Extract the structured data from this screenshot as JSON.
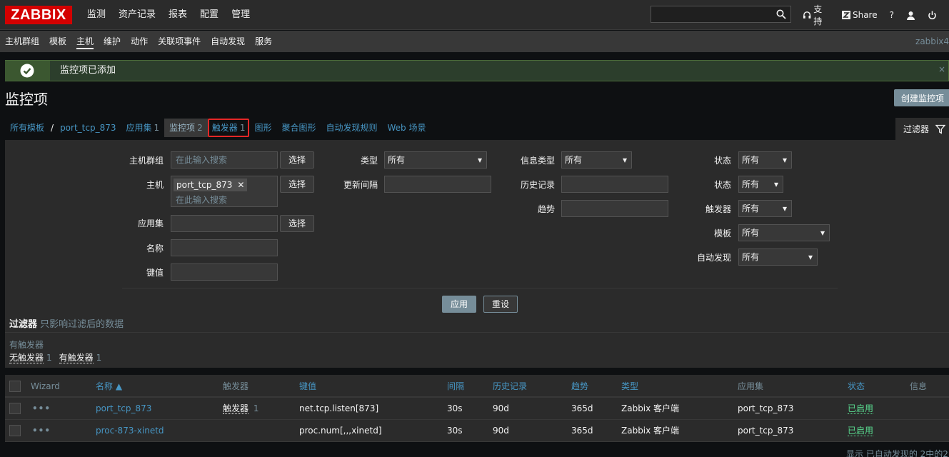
{
  "app": {
    "logo": "ZABBIX",
    "server_name": "zabbix4"
  },
  "main_menu": [
    "监测",
    "资产记录",
    "报表",
    "配置",
    "管理"
  ],
  "top_right": {
    "support": "支持",
    "share": "Share",
    "help": "?"
  },
  "sub_menu": [
    "主机群组",
    "模板",
    "主机",
    "维护",
    "动作",
    "关联项事件",
    "自动发现",
    "服务"
  ],
  "message": {
    "text": "监控项已添加",
    "close": "×"
  },
  "page": {
    "title": "监控项",
    "create_button": "创建监控项"
  },
  "breadcrumbs": {
    "all_templates": "所有模板",
    "sep": "/",
    "host": "port_tcp_873",
    "apps": {
      "label": "应用集",
      "count": "1"
    },
    "items": {
      "label": "监控项",
      "count": "2"
    },
    "triggers": {
      "label": "触发器",
      "count": "1"
    },
    "graphs": "图形",
    "screens": "聚合图形",
    "discovery": "自动发现规则",
    "web": "Web 场景"
  },
  "filter_tab": "过滤器",
  "filter": {
    "host_group": {
      "label": "主机群组",
      "placeholder": "在此输入搜索",
      "button": "选择"
    },
    "host": {
      "label": "主机",
      "tag": "port_tcp_873",
      "placeholder": "在此输入搜索",
      "button": "选择"
    },
    "application": {
      "label": "应用集",
      "button": "选择"
    },
    "name": {
      "label": "名称"
    },
    "key": {
      "label": "键值"
    },
    "type": {
      "label": "类型",
      "value": "所有"
    },
    "interval": {
      "label": "更新间隔"
    },
    "info_type": {
      "label": "信息类型",
      "value": "所有"
    },
    "history": {
      "label": "历史记录"
    },
    "trends": {
      "label": "趋势"
    },
    "state": {
      "label": "状态",
      "value": "所有"
    },
    "status": {
      "label": "状态",
      "value": "所有"
    },
    "triggers": {
      "label": "触发器",
      "value": "所有"
    },
    "template": {
      "label": "模板",
      "value": "所有"
    },
    "discovered": {
      "label": "自动发现",
      "value": "所有"
    },
    "apply": "应用",
    "reset": "重设"
  },
  "subfilter": {
    "title": "过滤器",
    "hint": "只影响过滤后的数据",
    "group_title": "有触发器",
    "no_triggers": {
      "label": "无触发器",
      "count": "1"
    },
    "with_triggers": {
      "label": "有触发器",
      "count": "1"
    }
  },
  "table": {
    "headers": {
      "wizard": "Wizard",
      "name": "名称 ▲",
      "triggers": "触发器",
      "key": "键值",
      "interval": "间隔",
      "history": "历史记录",
      "trends": "趋势",
      "type": "类型",
      "applications": "应用集",
      "status": "状态",
      "info": "信息"
    },
    "rows": [
      {
        "name": "port_tcp_873",
        "triggers": "触发器",
        "trigger_count": "1",
        "key": "net.tcp.listen[873]",
        "interval": "30s",
        "history": "90d",
        "trends": "365d",
        "type": "Zabbix 客户端",
        "applications": "port_tcp_873",
        "status": "已启用"
      },
      {
        "name": "proc-873-xinetd",
        "triggers": "",
        "trigger_count": "",
        "key": "proc.num[,,,xinetd]",
        "interval": "30s",
        "history": "90d",
        "trends": "365d",
        "type": "Zabbix 客户端",
        "applications": "port_tcp_873",
        "status": "已启用"
      }
    ]
  },
  "footer": "显示 已自动发现的 2中的2"
}
